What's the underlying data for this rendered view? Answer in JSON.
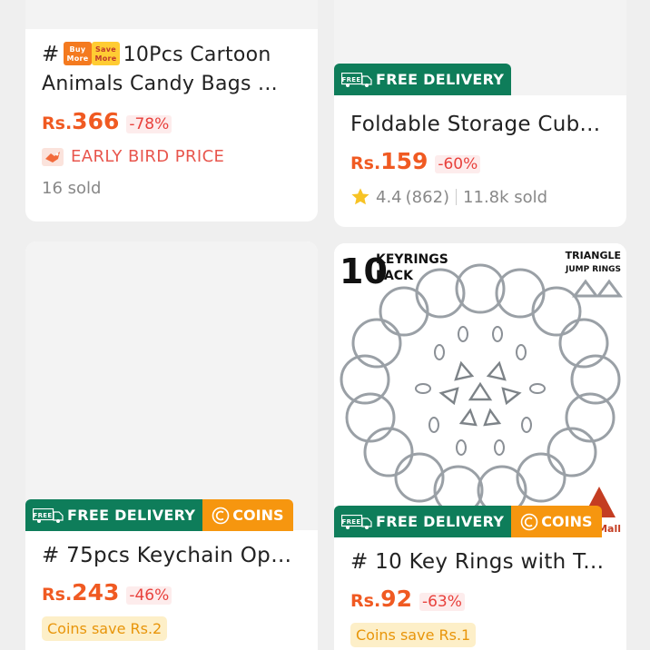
{
  "products": [
    {
      "hash": "#",
      "tag_buy_more": "Buy More",
      "tag_save_more": "Save More",
      "title": "10Pcs Cartoon Animals Candy Bags ...",
      "currency": "Rs.",
      "price": "366",
      "discount": "-78%",
      "early_bird": "EARLY BIRD PRICE",
      "sold": "16 sold"
    },
    {
      "badge_free": "FREE DELIVERY",
      "title": "Foldable Storage Cub...",
      "currency": "Rs.",
      "price": "159",
      "discount": "-60%",
      "rating": "4.4",
      "reviews": "(862)",
      "sold": "11.8k sold"
    },
    {
      "badge_free": "FREE DELIVERY",
      "badge_coins": "COINS",
      "title": "# 75pcs Keychain Ope...",
      "currency": "Rs.",
      "price": "243",
      "discount": "-46%",
      "coins_save": "Coins save Rs.2"
    },
    {
      "image": {
        "count": "10",
        "label1": "KEYRINGS",
        "label2": "PACK",
        "label3": "TRIANGLE",
        "label4": "JUMP RINGS",
        "mall": "Mall"
      },
      "badge_free": "FREE DELIVERY",
      "badge_coins": "COINS",
      "title": "# 10 Key Rings with Tri...",
      "currency": "Rs.",
      "price": "92",
      "discount": "-63%",
      "coins_save": "Coins save Rs.1"
    }
  ],
  "colors": {
    "price": "#f05a22",
    "free_delivery": "#0e7d5a",
    "coins": "#f6960f"
  },
  "icons": [
    "truck-icon",
    "coin-icon",
    "star-icon",
    "early-bird-icon"
  ]
}
